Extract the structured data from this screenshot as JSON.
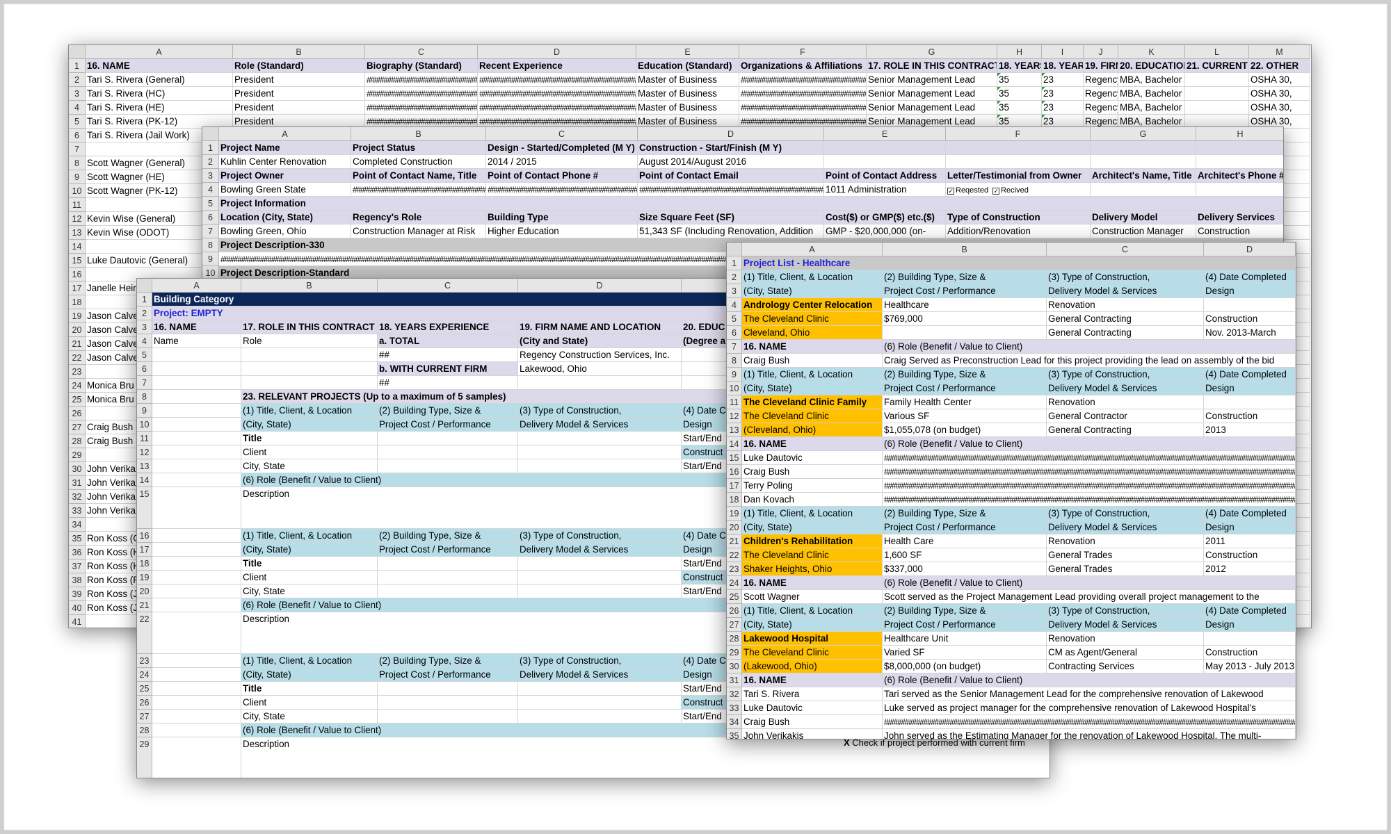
{
  "hash": "#########################################################################################",
  "s1": {
    "cols": [
      "A",
      "B",
      "C",
      "D",
      "E",
      "F",
      "G",
      "H",
      "I",
      "J",
      "K",
      "L",
      "M"
    ],
    "rows": [
      [
        "1",
        "16. NAME",
        "Role (Standard)",
        "Biography (Standard)",
        "Recent Experience",
        "Education (Standard)",
        "Organizations & Affiliations",
        "17. ROLE IN THIS CONTRACT",
        "18. YEARS",
        "18. YEARS",
        "19. FIRM",
        "20. EDUCATION",
        "21. CURRENT",
        "22. OTHER"
      ],
      [
        "2",
        "Tari S. Rivera (General)",
        "President",
        "",
        "",
        "Master of Business",
        "",
        "Senior Management Lead",
        "35",
        "23",
        "Regency",
        "MBA, Bachelor",
        "",
        "OSHA 30,"
      ],
      [
        "3",
        "Tari S. Rivera (HC)",
        "President",
        "",
        "",
        "Master of Business",
        "",
        "Senior Management Lead",
        "35",
        "23",
        "Regency",
        "MBA, Bachelor",
        "",
        "OSHA 30,"
      ],
      [
        "4",
        "Tari S. Rivera (HE)",
        "President",
        "",
        "",
        "Master of Business",
        "",
        "Senior Management Lead",
        "35",
        "23",
        "Regency",
        "MBA, Bachelor",
        "",
        "OSHA 30,"
      ],
      [
        "5",
        "Tari S. Rivera (PK-12)",
        "President",
        "",
        "",
        "Master of Business",
        "",
        "Senior Management Lead",
        "35",
        "23",
        "Regency",
        "MBA, Bachelor",
        "",
        "OSHA 30,"
      ],
      [
        "6",
        "Tari S. Rivera (Jail Work)"
      ],
      [
        "7",
        ""
      ],
      [
        "8",
        "Scott Wagner (General)"
      ],
      [
        "9",
        "Scott Wagner (HE)"
      ],
      [
        "10",
        "Scott Wagner (PK-12)"
      ],
      [
        "11",
        ""
      ],
      [
        "12",
        "Kevin Wise (General)"
      ],
      [
        "13",
        "Kevin Wise (ODOT)"
      ],
      [
        "14",
        ""
      ],
      [
        "15",
        "Luke Dautovic (General)"
      ],
      [
        "16",
        ""
      ],
      [
        "17",
        "Janelle Heir"
      ],
      [
        "18",
        ""
      ],
      [
        "19",
        "Jason Calve"
      ],
      [
        "20",
        "Jason Calve"
      ],
      [
        "21",
        "Jason Calve"
      ],
      [
        "22",
        "Jason Calve"
      ],
      [
        "23",
        ""
      ],
      [
        "24",
        "Monica Bru"
      ],
      [
        "25",
        "Monica Bru"
      ],
      [
        "26",
        ""
      ],
      [
        "27",
        "Craig Bush ("
      ],
      [
        "28",
        "Craig Bush ("
      ],
      [
        "29",
        ""
      ],
      [
        "30",
        "John Verika"
      ],
      [
        "31",
        "John Verika"
      ],
      [
        "32",
        "John Verika"
      ],
      [
        "33",
        "John Verika"
      ],
      [
        "34",
        ""
      ],
      [
        "35",
        "Ron Koss (G"
      ],
      [
        "36",
        "Ron Koss (H"
      ],
      [
        "37",
        "Ron Koss (H"
      ],
      [
        "38",
        "Ron Koss (P"
      ],
      [
        "39",
        "Ron Koss (Ja"
      ],
      [
        "40",
        "Ron Koss (Ja"
      ],
      [
        "41",
        ""
      ]
    ],
    "right_edge": [
      "A 30,",
      "A 30,",
      "A 30,",
      "A 30",
      "A 30",
      "0"
    ]
  },
  "s2": {
    "cols": [
      "A",
      "B",
      "C",
      "D",
      "E",
      "F",
      "G",
      "H"
    ],
    "r1": [
      "Project Name",
      "Project Status",
      "Design - Started/Completed (M Y)",
      "Construction - Start/Finish (M Y)"
    ],
    "r2": [
      "Kuhlin Center Renovation",
      "Completed Construction",
      "2014 / 2015",
      "August 2014/August 2016"
    ],
    "r3": [
      "Project Owner",
      "Point of  Contact Name, Title",
      "Point of  Contact Phone #",
      "Point of  Contact Email",
      "Point of  Contact Address",
      "Letter/Testimonial from Owner",
      "Architect's Name, Title",
      "Architect's Phone #"
    ],
    "r4": [
      "Bowling Green State",
      "",
      "",
      "",
      "1011 Administration",
      "Reqested",
      "Recived"
    ],
    "r5": "Project Information",
    "r6": [
      "Location (City, State)",
      "Regency's Role",
      "Building Type",
      "Size Square Feet (SF)",
      "Cost($) or GMP($) etc.($)",
      "Type of Construction",
      "Delivery Model",
      "Delivery Services"
    ],
    "r7": [
      "Bowling Green, Ohio",
      "Construction Manager at Risk",
      "Higher Education",
      "51,343 SF (Including Renovation, Addition",
      "GMP - $20,000,000 (on-",
      "Addition/Renovation",
      "Construction Manager",
      "Construction"
    ],
    "r8": "Project Description-330",
    "r10": "Project Description-Standard"
  },
  "s3": {
    "cols": [
      "A",
      "B",
      "C",
      "D",
      "E"
    ],
    "title": "Building Category",
    "project": "Project: EMPTY",
    "r3": [
      "16. NAME",
      "17. ROLE IN THIS CONTRACT",
      "18. YEARS EXPERIENCE",
      "19. FIRM NAME AND LOCATION",
      "20. EDUC"
    ],
    "r4": [
      "Name",
      "Role",
      "a. TOTAL",
      "(City and State)",
      "(Degree a"
    ],
    "r5_c": "##",
    "r5_d": "Regency Construction Services, Inc.",
    "r6_c": "b. WITH CURRENT FIRM",
    "r6_d": "Lakewood, Ohio",
    "r7_c": "##",
    "r8": "23. RELEVANT PROJECTS (Up to a maximum of 5 samples)",
    "blk_h1": [
      "(1) Title, Client, & Location",
      "(2) Building Type, Size &",
      "(3) Type of Construction,",
      "(4) Date C"
    ],
    "blk_h2": [
      "(City, State)",
      "Project Cost / Performance",
      "Delivery Model & Services",
      "Design"
    ],
    "blk_title": "Title",
    "blk_client": "Client",
    "blk_city": "City, State",
    "blk_e1": "Start/End",
    "blk_e2": "Construct",
    "blk_e3": "Start/End",
    "blk_role": "(6) Role (Benefit / Value to Client)",
    "blk_desc": "Description",
    "footer": "Check if project performed with current firm",
    "footer_x": "X"
  },
  "s4": {
    "cols": [
      "A",
      "B",
      "C",
      "D"
    ],
    "title": "Project List - Healthcare",
    "hdr1": [
      "(1) Title, Client, & Location",
      "(2) Building Type, Size &",
      "(3) Type of Construction,",
      "(4) Date Completed"
    ],
    "hdr2": [
      "(City, State)",
      "Project Cost / Performance",
      "Delivery Model & Services",
      "Design"
    ],
    "p1": [
      [
        "Andrology Center Relocation",
        "Healthcare",
        "Renovation",
        ""
      ],
      [
        "The Cleveland Clinic",
        "$769,000",
        "General Contracting",
        "Construction"
      ],
      [
        "Cleveland, Ohio",
        "",
        "General Contracting",
        "Nov. 2013-March"
      ]
    ],
    "nh": [
      "16. NAME",
      "(6) Role (Benefit / Value to Client)"
    ],
    "n1": [
      [
        "Craig Bush",
        "Craig Served as Preconstruction Lead for this project providing the lead on assembly of the bid"
      ]
    ],
    "p2": [
      [
        "The Cleveland Clinic Family",
        "Family Health Center",
        "Renovation",
        ""
      ],
      [
        "The Cleveland Clinic",
        "Various SF",
        "General Contractor",
        "Construction"
      ],
      [
        "(Cleveland, Ohio)",
        "$1,055,078 (on budget)",
        "General Contracting",
        "2013"
      ]
    ],
    "n2": [
      [
        "Luke Dautovic",
        ""
      ],
      [
        "Craig Bush",
        ""
      ],
      [
        "Terry Poling",
        ""
      ],
      [
        "Dan Kovach",
        ""
      ]
    ],
    "p3": [
      [
        "Children's Rehabilitation",
        "Health Care",
        "Renovation",
        "2011"
      ],
      [
        "The Cleveland Clinic",
        "1,600 SF",
        "General Trades",
        "Construction"
      ],
      [
        "Shaker Heights, Ohio",
        "$337,000",
        "General Trades",
        "2012"
      ]
    ],
    "n3": [
      [
        "Scott Wagner",
        "Scott served as the Project Management Lead providing overall project management to the"
      ]
    ],
    "p4": [
      [
        "Lakewood Hospital",
        "Healthcare Unit",
        "Renovation",
        ""
      ],
      [
        "The Cleveland Clinic",
        "Varied SF",
        "CM as Agent/General",
        "Construction"
      ],
      [
        "(Lakewood, Ohio)",
        "$8,000,000 (on budget)",
        "Contracting Services",
        "May 2013 - July 2013"
      ]
    ],
    "n4": [
      [
        "Tari S. Rivera",
        "Tari served as the Senior Management Lead for the comprehensive renovation of Lakewood"
      ],
      [
        "Luke Dautovic",
        "Luke served as project manager for the comprehensive renovation of Lakewood Hospital's"
      ],
      [
        "Craig Bush",
        ""
      ],
      [
        "John Verikakis",
        "John served as the Estimating Manager for the renovation of Lakewood Hospital. The multi-"
      ]
    ]
  }
}
